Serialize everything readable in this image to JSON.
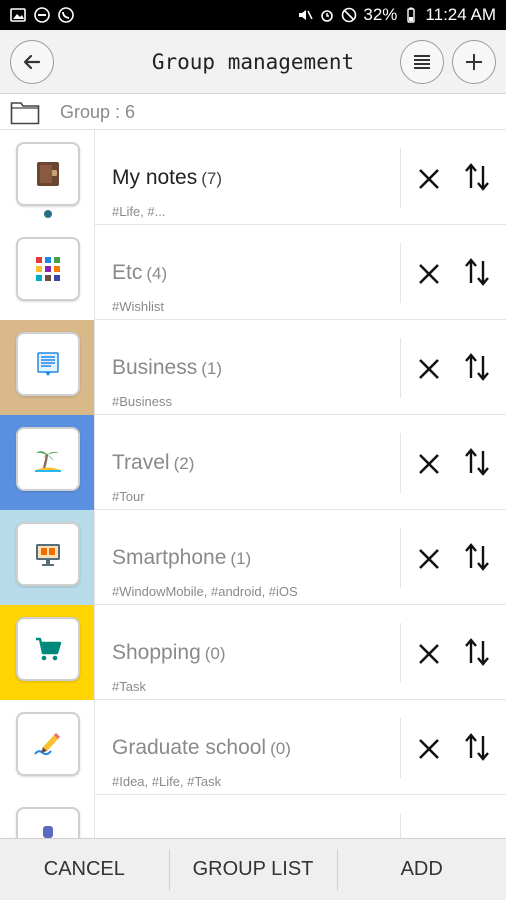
{
  "status_bar": {
    "battery": "32%",
    "time": "11:24 AM"
  },
  "app_bar": {
    "title": "Group management",
    "back_icon": "arrow-left-icon",
    "menu_icon": "list-icon",
    "add_icon": "plus-icon"
  },
  "group_info": {
    "label": "Group : 6",
    "icon": "folder-icon"
  },
  "groups": [
    {
      "name": "My notes",
      "count": "(7)",
      "tags": "#Life, #...",
      "color": "#ffffff",
      "icon": "notebook-icon",
      "active": true
    },
    {
      "name": "Etc",
      "count": "(4)",
      "tags": "#Wishlist",
      "color": "#ffffff",
      "icon": "apps-grid-icon",
      "active": false
    },
    {
      "name": "Business",
      "count": "(1)",
      "tags": "#Business",
      "color": "#d9b98a",
      "icon": "document-icon",
      "active": false
    },
    {
      "name": "Travel",
      "count": "(2)",
      "tags": "#Tour",
      "color": "#5b8fe0",
      "icon": "palm-tree-icon",
      "active": false
    },
    {
      "name": "Smartphone",
      "count": "(1)",
      "tags": "#WindowMobile, #android, #iOS",
      "color": "#b7dbe8",
      "icon": "monitor-icon",
      "active": false
    },
    {
      "name": "Shopping",
      "count": "(0)",
      "tags": "#Task",
      "color": "#ffd400",
      "icon": "cart-icon",
      "active": false
    },
    {
      "name": "Graduate school",
      "count": "(0)",
      "tags": "#Idea, #Life, #Task",
      "color": "#ffffff",
      "icon": "pencil-writing-icon",
      "active": false
    }
  ],
  "bottom_bar": {
    "cancel": "CANCEL",
    "group_list": "GROUP LIST",
    "add": "ADD"
  }
}
